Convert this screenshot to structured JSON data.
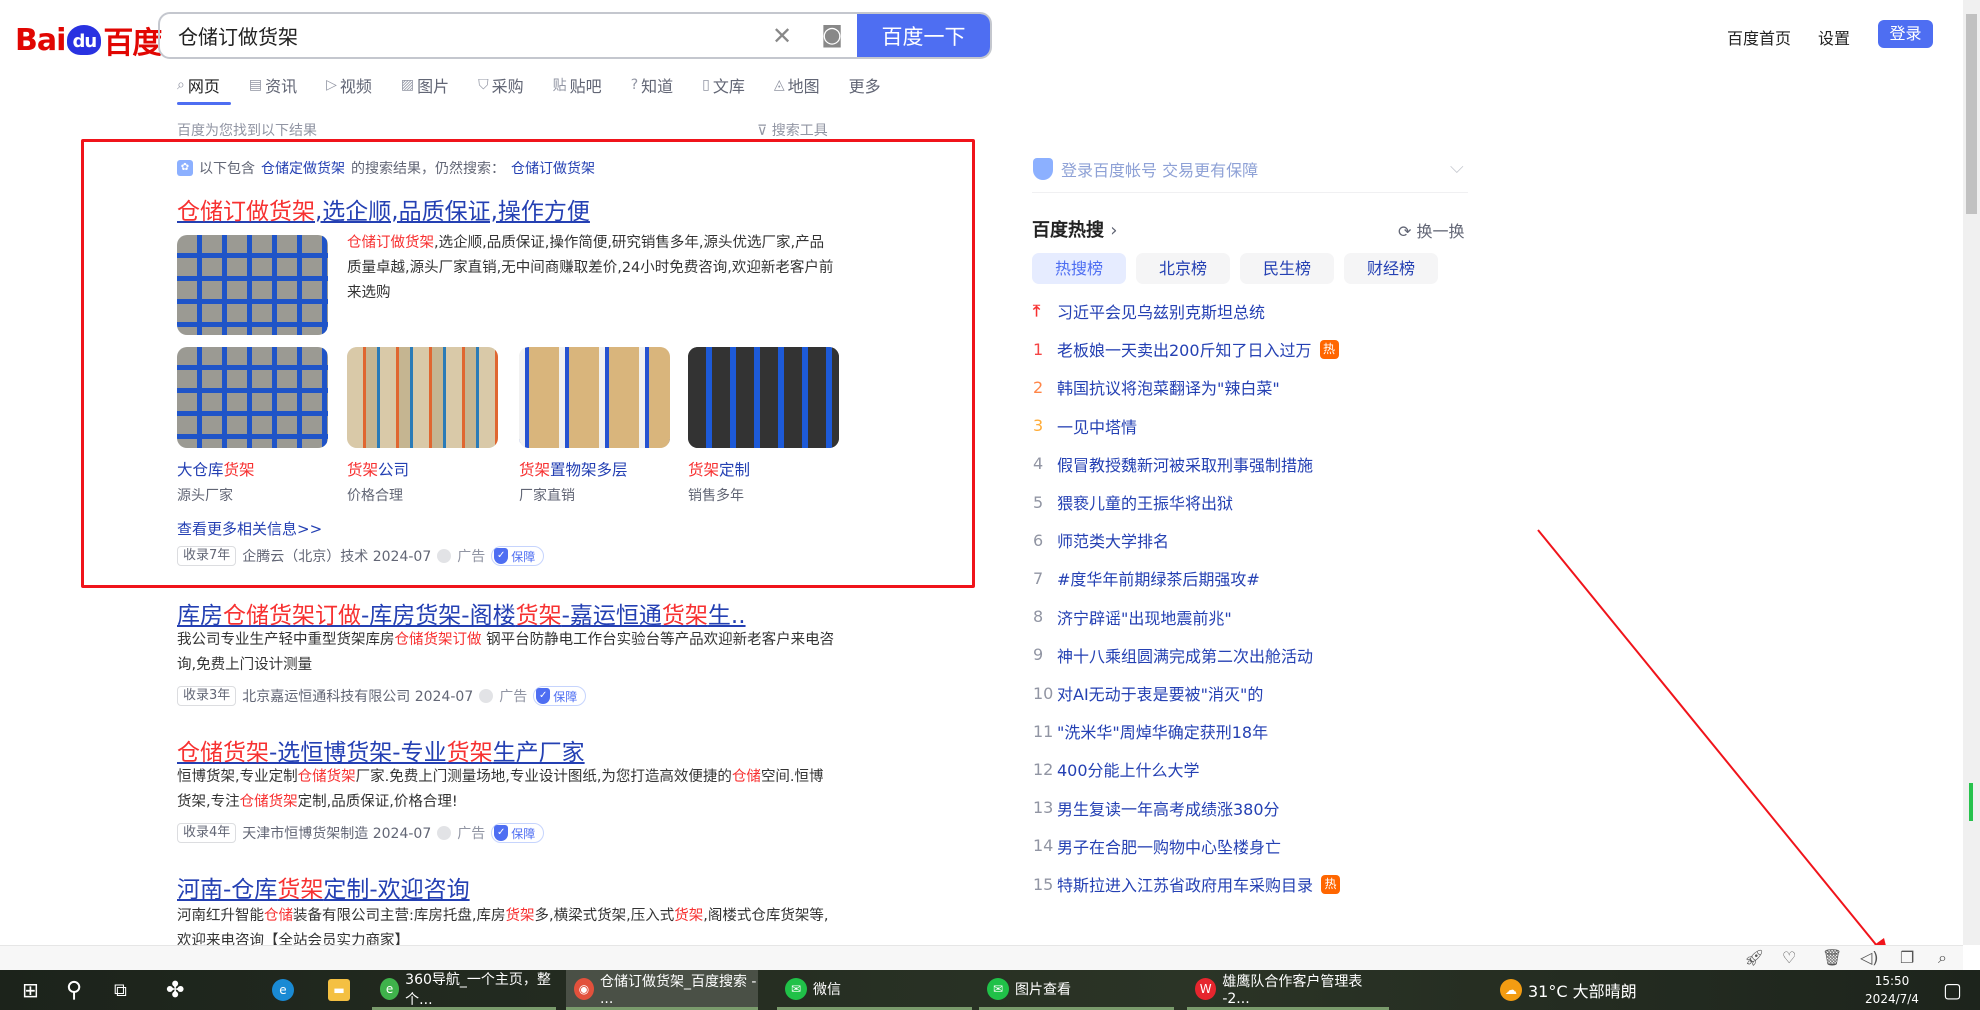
{
  "header": {
    "logo_text": "Bai du 百度",
    "search_value": "仓储订做货架",
    "search_button": "百度一下",
    "links": [
      "百度首页",
      "设置"
    ],
    "login": "登录"
  },
  "tabs": [
    {
      "icon": "⌕",
      "label": "网页"
    },
    {
      "icon": "▤",
      "label": "资讯"
    },
    {
      "icon": "▷",
      "label": "视频"
    },
    {
      "icon": "▨",
      "label": "图片"
    },
    {
      "icon": "⛉",
      "label": "采购"
    },
    {
      "icon": "贴",
      "label": "贴吧"
    },
    {
      "icon": "?",
      "label": "知道"
    },
    {
      "icon": "▯",
      "label": "文库"
    },
    {
      "icon": "◬",
      "label": "地图"
    },
    {
      "icon": "",
      "label": "更多"
    }
  ],
  "found_text": "百度为您找到以下结果",
  "search_tools": "搜索工具",
  "notice": {
    "prefix": "以下包含",
    "term": "仓储定做货架",
    "middle": "的搜索结果，仍然搜索：",
    "original": "仓储订做货架"
  },
  "ad1": {
    "title": [
      [
        "仓储订做货架",
        true
      ],
      [
        ",选企顺,品质保证,操作方便",
        false
      ]
    ],
    "desc": [
      [
        "仓储订做货架",
        true
      ],
      [
        ",选企顺,品质保证,操作简便,研究销售多年,源头优选厂家,产品质量卓越,源头厂家直销,无中间商赚取差价,24小时免费咨询,欢迎新老客户前来选购",
        false
      ]
    ],
    "items": [
      {
        "title": [
          [
            "大仓库",
            false
          ],
          [
            "货架",
            true
          ]
        ],
        "sub": "源头厂家"
      },
      {
        "title": [
          [
            "货架",
            true
          ],
          [
            "公司",
            false
          ]
        ],
        "sub": "价格合理"
      },
      {
        "title": [
          [
            "货架",
            true
          ],
          [
            "置物架多层",
            false
          ]
        ],
        "sub": "厂家直销"
      },
      {
        "title": [
          [
            "货架",
            true
          ],
          [
            "定制",
            false
          ]
        ],
        "sub": "销售多年"
      }
    ],
    "more": "查看更多相关信息>>",
    "meta": {
      "tag": "收录7年",
      "source": "企腾云（北京）技术 2024-07",
      "ad": "广告",
      "guarantee": "保障"
    }
  },
  "results": [
    {
      "title": [
        [
          "库房",
          false
        ],
        [
          "仓储货架订做",
          true
        ],
        [
          "-库房货架-阁楼",
          false
        ],
        [
          "货架",
          true
        ],
        [
          "-嘉运恒通",
          false
        ],
        [
          "货架",
          true
        ],
        [
          "生..",
          false
        ]
      ],
      "desc": [
        [
          "我公司专业生产轻中重型货架库房",
          false
        ],
        [
          "仓储货架订做",
          true
        ],
        [
          " 钢平台防静电工作台实验台等产品欢迎新老客户来电咨询,免费上门设计测量",
          false
        ]
      ],
      "meta": {
        "tag": "收录3年",
        "source": "北京嘉运恒通科技有限公司 2024-07",
        "ad": "广告",
        "guarantee": "保障"
      }
    },
    {
      "title": [
        [
          "仓储货架",
          true
        ],
        [
          "-选恒博货架-专业",
          false
        ],
        [
          "货架",
          true
        ],
        [
          "生产厂家",
          false
        ]
      ],
      "desc": [
        [
          "恒博货架,专业定制",
          false
        ],
        [
          "仓储货架",
          true
        ],
        [
          "厂家.免费上门测量场地,专业设计图纸,为您打造高效便捷的",
          false
        ],
        [
          "仓储",
          true
        ],
        [
          "空间.恒博货架,专注",
          false
        ],
        [
          "仓储货架",
          true
        ],
        [
          "定制,品质保证,价格合理!",
          false
        ]
      ],
      "meta": {
        "tag": "收录4年",
        "source": "天津市恒博货架制造 2024-07",
        "ad": "广告",
        "guarantee": "保障"
      }
    },
    {
      "title": [
        [
          "河南-仓库",
          false
        ],
        [
          "货架",
          true
        ],
        [
          "定制-欢迎咨询",
          false
        ]
      ],
      "desc": [
        [
          "河南红升智能",
          false
        ],
        [
          "仓储",
          true
        ],
        [
          "装备有限公司主营:库房托盘,库房",
          false
        ],
        [
          "货架",
          true
        ],
        [
          "多,横梁式货架,压入式",
          false
        ],
        [
          "货架",
          true
        ],
        [
          ",阁楼式仓库货架等,欢迎来电咨询【全站会员实力商家】",
          false
        ]
      ]
    }
  ],
  "sidebar": {
    "login_notice": "登录百度帐号 交易更有保障",
    "hot_title": "百度热搜",
    "refresh": "换一换",
    "hot_tabs": [
      "热搜榜",
      "北京榜",
      "民生榜",
      "财经榜"
    ],
    "hot_badge": "热",
    "hot_items": [
      {
        "rank": "",
        "text": "习近平会见乌兹别克斯坦总统",
        "hot": false
      },
      {
        "rank": "1",
        "text": "老板娘一天卖出200斤知了日入过万",
        "hot": true
      },
      {
        "rank": "2",
        "text": "韩国抗议将泡菜翻译为\"辣白菜\"",
        "hot": false
      },
      {
        "rank": "3",
        "text": "一见中塔情",
        "hot": false
      },
      {
        "rank": "4",
        "text": "假冒教授魏新河被采取刑事强制措施",
        "hot": false
      },
      {
        "rank": "5",
        "text": "猥亵儿童的王振华将出狱",
        "hot": false
      },
      {
        "rank": "6",
        "text": "师范类大学排名",
        "hot": false
      },
      {
        "rank": "7",
        "text": "#度华年前期绿茶后期强攻#",
        "hot": false
      },
      {
        "rank": "8",
        "text": "济宁辟谣\"出现地震前兆\"",
        "hot": false
      },
      {
        "rank": "9",
        "text": "神十八乘组圆满完成第二次出舱活动",
        "hot": false
      },
      {
        "rank": "10",
        "text": "对AI无动于衷是要被\"消灭\"的",
        "hot": false
      },
      {
        "rank": "11",
        "text": "\"洗米华\"周焯华确定获刑18年",
        "hot": false
      },
      {
        "rank": "12",
        "text": "400分能上什么大学",
        "hot": false
      },
      {
        "rank": "13",
        "text": "男生复读一年高考成绩涨380分",
        "hot": false
      },
      {
        "rank": "14",
        "text": "男子在合肥一购物中心坠楼身亡",
        "hot": false
      },
      {
        "rank": "15",
        "text": "特斯拉进入江苏省政府用车采购目录",
        "hot": true
      }
    ],
    "rank_colors": {
      "top": "#f73131",
      "1": "#f54545",
      "2": "#ff8547",
      "3": "#ffac38",
      "default": "#9195a3"
    }
  },
  "taskbar": {
    "apps": [
      {
        "label": "360导航_一个主页，整个...",
        "icon": "e",
        "color": "#3fb24b"
      },
      {
        "label": "仓储订做货架_百度搜索 - ...",
        "icon": "◉",
        "color": "#e2513c"
      },
      {
        "label": "微信",
        "icon": "✉",
        "color": "#20c148"
      },
      {
        "label": "图片查看",
        "icon": "✉",
        "color": "#20c148"
      },
      {
        "label": "雄鹰队合作客户管理表 -2...",
        "icon": "W",
        "color": "#e6262e"
      }
    ],
    "weather": "31°C  大部晴朗",
    "time": "15:50",
    "date": "2024/7/4"
  }
}
